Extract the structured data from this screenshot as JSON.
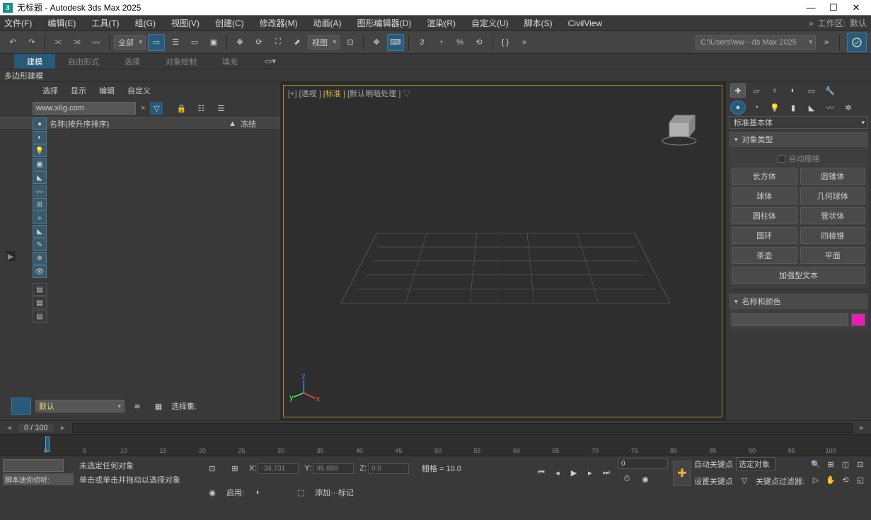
{
  "title": "无标题 - Autodesk 3ds Max 2025",
  "menu": {
    "file": "文件(F)",
    "edit": "编辑(E)",
    "tools": "工具(T)",
    "group": "组(G)",
    "views": "视图(V)",
    "create": "创建(C)",
    "modifiers": "修改器(M)",
    "animation": "动画(A)",
    "graph": "图形编辑器(D)",
    "render": "渲染(R)",
    "custom": "自定义(U)",
    "script": "脚本(S)",
    "civil": "CivilView",
    "wslabel": "工作区:",
    "wsval": "默认"
  },
  "tb": {
    "allcombo": "全部",
    "viewcombo": "视图",
    "path": "C:\\Users\\ww···ds Max 2025"
  },
  "ribbon": {
    "t1": "建模",
    "t2": "自由形式",
    "t3": "选择",
    "t4": "对象绘制",
    "t5": "填充",
    "sub": "多边形建模"
  },
  "lp": {
    "tabs": {
      "sel": "选择",
      "disp": "显示",
      "edit": "编辑",
      "cust": "自定义"
    },
    "search": "www.x6g.com",
    "hname": "名称(按升序排序)",
    "hfrz": "冻结",
    "layer": "默认",
    "selset": "选择集:"
  },
  "vp": {
    "plus": "[+]",
    "persp": "[透视 ]",
    "std": "[标准 ]",
    "shade": "[默认明暗处理 ]"
  },
  "rp": {
    "dropdown": "标准基本体",
    "roll1": "对象类型",
    "autogrid": "自动栅格",
    "btns": [
      "长方体",
      "圆锥体",
      "球体",
      "几何球体",
      "圆柱体",
      "管状体",
      "圆环",
      "四棱锥",
      "茶壶",
      "平面",
      "加强型文本"
    ],
    "roll2": "名称和颜色"
  },
  "time": {
    "frame": "0 / 100",
    "ticks": [
      0,
      5,
      10,
      15,
      20,
      25,
      30,
      35,
      40,
      45,
      50,
      55,
      60,
      65,
      70,
      75,
      80,
      85,
      90,
      95,
      100
    ]
  },
  "status": {
    "mini": "脚本迷你侦听:",
    "msg1": "未选定任何对象",
    "msg2": "单击或单击并拖动以选择对象",
    "x": "X:",
    "xval": "-34.731",
    "y": "Y:",
    "yval": "95.688",
    "z": "Z:",
    "zval": "0.0",
    "grid": "栅格 = 10.0",
    "enable": "启用:",
    "add": "添加···标记",
    "framenum": "0",
    "autokey": "自动关键点",
    "selobj": "选定对象",
    "setkey": "设置关键点",
    "keyfilter": "关键点过滤器:"
  }
}
